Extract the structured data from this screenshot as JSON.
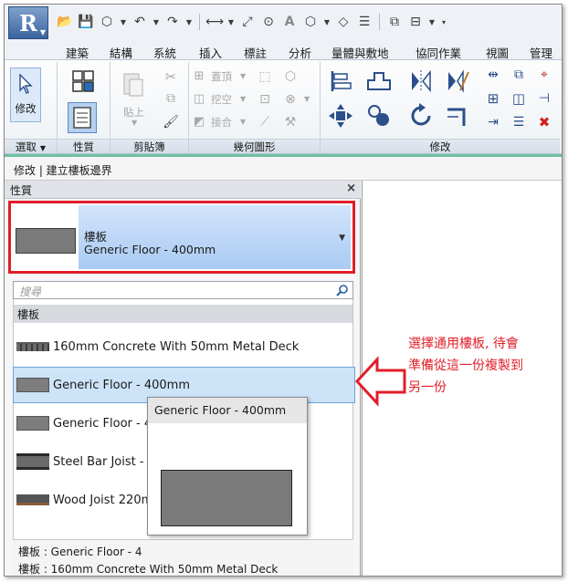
{
  "app": {
    "logo_letter": "R"
  },
  "tabs": [
    "建築",
    "結構",
    "系統",
    "插入",
    "標註",
    "分析",
    "量體與敷地",
    "協同作業",
    "視圖",
    "管理"
  ],
  "ribbon": {
    "modify_label": "修改",
    "panels": {
      "select": "選取",
      "properties": "性質",
      "clipboard": "剪貼簿",
      "geometry": "幾何圖形",
      "modify": "修改"
    },
    "clipboard": {
      "paste": "貼上"
    },
    "geometry": {
      "cope": "蓋頂",
      "cut": "挖空",
      "join": "接合"
    }
  },
  "context_bar": "修改 | 建立樓板邊界",
  "properties": {
    "title": "性質",
    "close": "×",
    "type_family": "樓板",
    "type_name": "Generic Floor - 400mm",
    "search_placeholder": "搜尋",
    "group": "樓板",
    "items": [
      "160mm Concrete With 50mm Metal Deck",
      "Generic Floor - 400mm",
      "Generic Floor - 4",
      "Steel Bar Joist - V",
      "Wood Joist 220m"
    ],
    "recent": [
      "樓板 : Generic Floor - 4",
      "樓板 : 160mm Concrete With 50mm Metal Deck"
    ]
  },
  "tooltip": {
    "title": "Generic Floor - 400mm"
  },
  "annotation": [
    "選擇通用樓板, 待會",
    "準備從這一份複製到",
    "另一份"
  ],
  "colors": {
    "annotation_red": "#e01e28",
    "selection_blue": "#cde3f8",
    "ribbon_accent": "#2a4f8a"
  }
}
